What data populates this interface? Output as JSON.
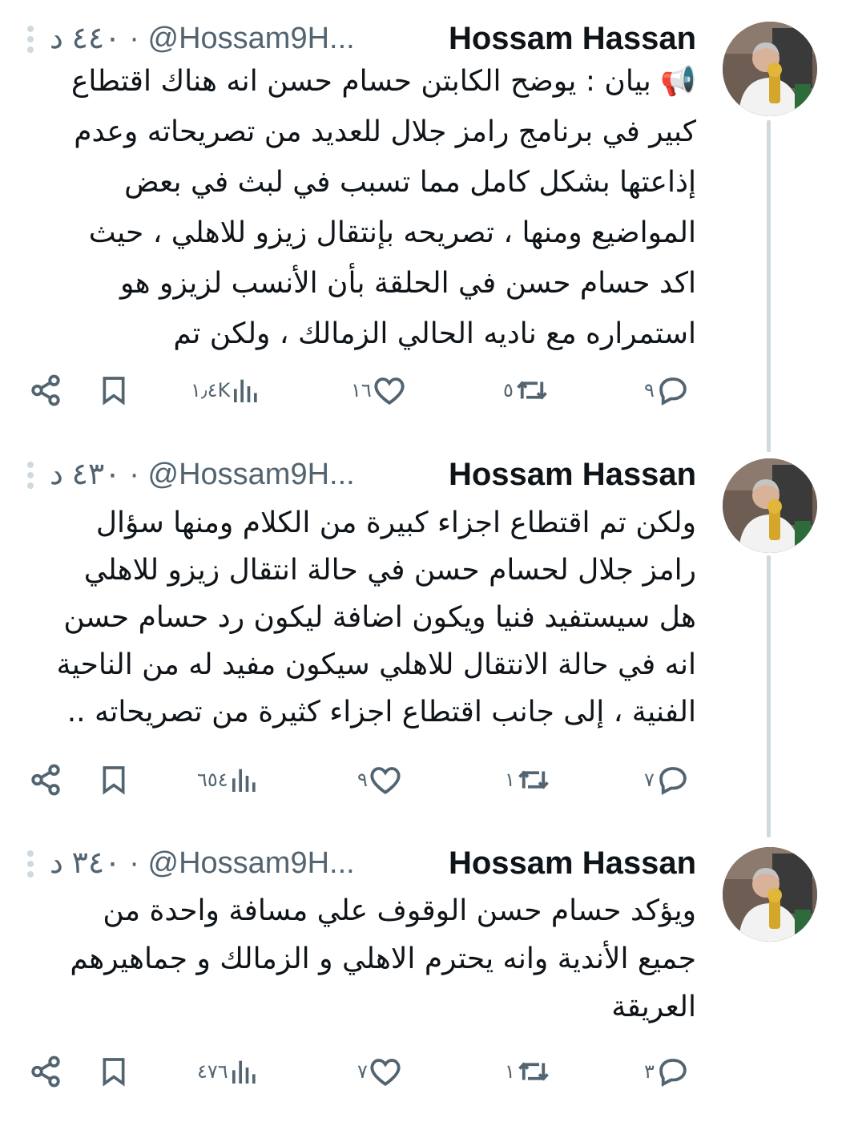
{
  "tweets": [
    {
      "name": "Hossam Hassan",
      "handle": "@Hossam9H...",
      "time": "٤٤٠ د",
      "lead_emoji": "📢",
      "text_lines": [
        "بيان : يوضح الكابتن حسام حسن انه هناك اقتطاع",
        "كبير في  برنامج رامز جلال للعديد من تصريحاته وعدم",
        "إذاعتها بشكل كامل مما تسبب في لبث في بعض",
        "المواضيع ومنها ، تصريحه بإنتقال زيزو للاهلي ، حيث",
        "اكد حسام حسن في الحلقة بأن الأنسب لزيزو هو",
        "استمراره مع ناديه الحالي الزمالك ، ولكن تم"
      ],
      "replies": "٩",
      "retweets": "٥",
      "likes": "١٦",
      "views": "١٫٤K"
    },
    {
      "name": "Hossam Hassan",
      "handle": "@Hossam9H...",
      "time": "٤٣٠ د",
      "text_lines": [
        "ولكن تم اقتطاع اجزاء كبيرة من الكلام ومنها سؤال",
        "رامز جلال لحسام حسن في حالة انتقال زيزو للاهلي",
        "هل سيستفيد فنيا ويكون اضافة ليكون رد حسام حسن",
        "انه في حالة الانتقال للاهلي سيكون مفيد له من الناحية",
        "الفنية ، إلى جانب اقتطاع اجزاء كثيرة من تصريحاته ..",
        ""
      ],
      "replies": "٧",
      "retweets": "١",
      "likes": "٩",
      "views": "٦٥٤"
    },
    {
      "name": "Hossam Hassan",
      "handle": "@Hossam9H...",
      "time": "٣٤٠ د",
      "text_lines": [
        "ويؤكد حسام حسن الوقوف علي مسافة واحدة من",
        "جميع الأندية وانه يحترم الاهلي و الزمالك و جماهيرهم",
        "العريقة",
        "",
        "",
        ""
      ],
      "replies": "٣",
      "retweets": "١",
      "likes": "٧",
      "views": "٤٧٦"
    }
  ],
  "colors": {
    "text": "#0f1419",
    "secondary": "#536471",
    "thread_line": "#cfd9de"
  },
  "icons": [
    "share-icon",
    "bookmark-icon",
    "views-icon",
    "like-icon",
    "retweet-icon",
    "reply-icon",
    "more-icon"
  ]
}
